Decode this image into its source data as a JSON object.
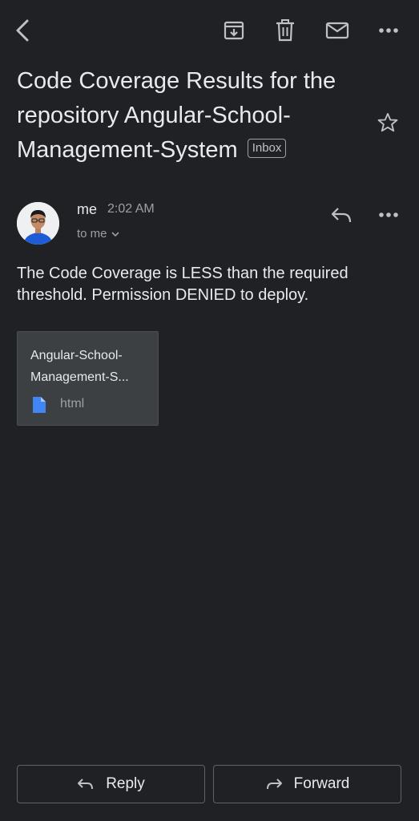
{
  "toolbar": {
    "icons": [
      "back-arrow-icon",
      "archive-icon",
      "trash-icon",
      "mail-icon",
      "more-icon"
    ]
  },
  "email": {
    "subject": "Code Coverage Results for the repository Angular-School-Management-System",
    "label": "Inbox",
    "sender": "me",
    "time": "2:02 AM",
    "recipient": "to me",
    "body": "The Code Coverage is LESS than the required threshold. Permission DENIED to deploy.",
    "attachment": {
      "name": "Angular-School-Management-S...",
      "type": "html"
    }
  },
  "actions": {
    "reply_label": "Reply",
    "forward_label": "Forward"
  },
  "colors": {
    "background": "#202124",
    "text": "#e8eaed",
    "muted": "#9aa0a6",
    "attachment_bg": "#3c4043",
    "file_icon": "#4285f4"
  }
}
